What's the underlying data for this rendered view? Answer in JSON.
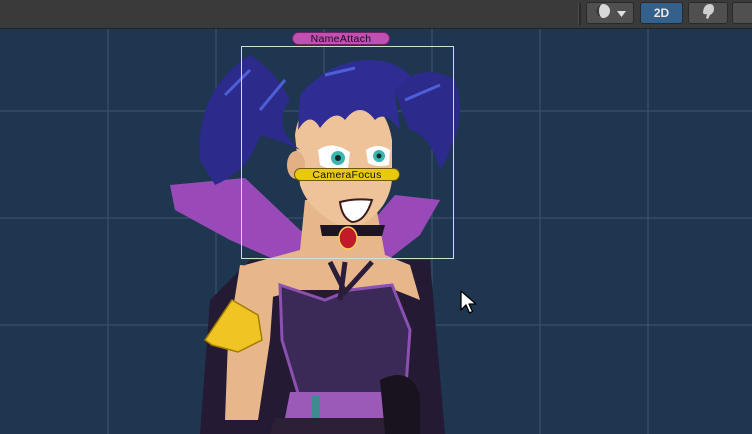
{
  "toolbar": {
    "mode_2d_label": "2D",
    "shading_icon": "sphere-shading-icon",
    "dropdown_icon": "chevron-down-icon",
    "audio_icon": "audio-icon"
  },
  "scene": {
    "name_attach_label": "NameAttach",
    "camera_focus_label": "CameraFocus"
  },
  "colors": {
    "background": "#1f3650",
    "grid_line": "#3d5571",
    "name_tag": "#c24fb3",
    "camera_tag": "#e8c910",
    "toolbar": "#3a3a3a",
    "mode_active": "#34608c"
  }
}
